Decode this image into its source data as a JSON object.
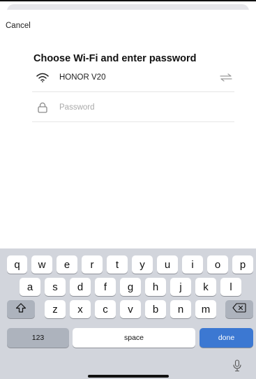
{
  "header": {
    "cancel_label": "Cancel"
  },
  "main": {
    "title": "Choose Wi-Fi and enter password",
    "network_name": "HONOR V20",
    "password_placeholder": "Password",
    "password_value": ""
  },
  "keyboard": {
    "row1": [
      "q",
      "w",
      "e",
      "r",
      "t",
      "y",
      "u",
      "i",
      "o",
      "p"
    ],
    "row2": [
      "a",
      "s",
      "d",
      "f",
      "g",
      "h",
      "j",
      "k",
      "l"
    ],
    "row3": [
      "z",
      "x",
      "c",
      "v",
      "b",
      "n",
      "m"
    ],
    "numbers_label": "123",
    "space_label": "space",
    "done_label": "done"
  },
  "icons": {
    "wifi": "wifi-icon",
    "lock": "lock-icon",
    "switch": "switch-network-icon",
    "shift": "shift-icon",
    "backspace": "backspace-icon",
    "mic": "microphone-icon"
  },
  "colors": {
    "done_key": "#3c78d2",
    "keyboard_bg": "#d2d5dc"
  }
}
